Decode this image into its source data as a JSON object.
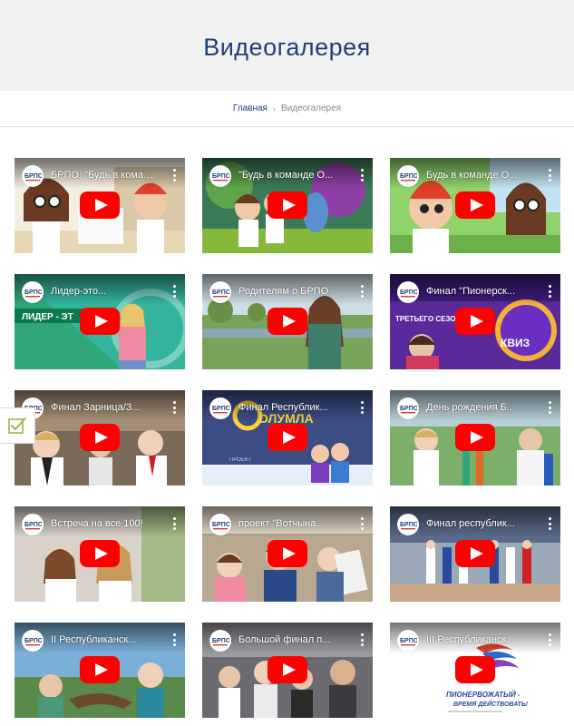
{
  "page": {
    "title": "Видеогалерея",
    "accent_color": "#1f3f7a",
    "play_color": "#ff0000"
  },
  "breadcrumb": {
    "home": "Главная",
    "separator": "›",
    "current": "Видеогалерея"
  },
  "videos": [
    {
      "title": "БРПО: \"Будь в команде О...",
      "theme": "cartoon-girl-boy"
    },
    {
      "title": "\"Будь в команде О...",
      "theme": "cartoon-forest"
    },
    {
      "title": "Будь в команде О...",
      "theme": "cartoon-boy-girl"
    },
    {
      "title": "Лидер-это...",
      "theme": "green-leader"
    },
    {
      "title": "Родителям о БРПО",
      "theme": "park-woman"
    },
    {
      "title": "Финал \"Пионерск...",
      "theme": "purple-quiz"
    },
    {
      "title": "Финал Зарница/З...",
      "theme": "kids-crowd"
    },
    {
      "title": "Финал Республик...",
      "theme": "cartoon-heroes"
    },
    {
      "title": "День рождения Б...",
      "theme": "outdoor-party"
    },
    {
      "title": "Встреча на все 100!",
      "theme": "indoor-girls"
    },
    {
      "title": "проект \"Вотчына...",
      "theme": "indoor-teens"
    },
    {
      "title": "Финал республик...",
      "theme": "hall-parade"
    },
    {
      "title": "II Республиканск...",
      "theme": "sky-kids"
    },
    {
      "title": "Большой финал п...",
      "theme": "event-crowd"
    },
    {
      "title": "III Республиканск...",
      "theme": "logo-white"
    }
  ],
  "video_badges": {
    "avatar_icon": "brpo-logo-icon",
    "menu_icon": "kebab-menu-icon",
    "play_icon": "youtube-play-icon"
  },
  "side_widget": {
    "icon": "checkbox-check-icon"
  }
}
